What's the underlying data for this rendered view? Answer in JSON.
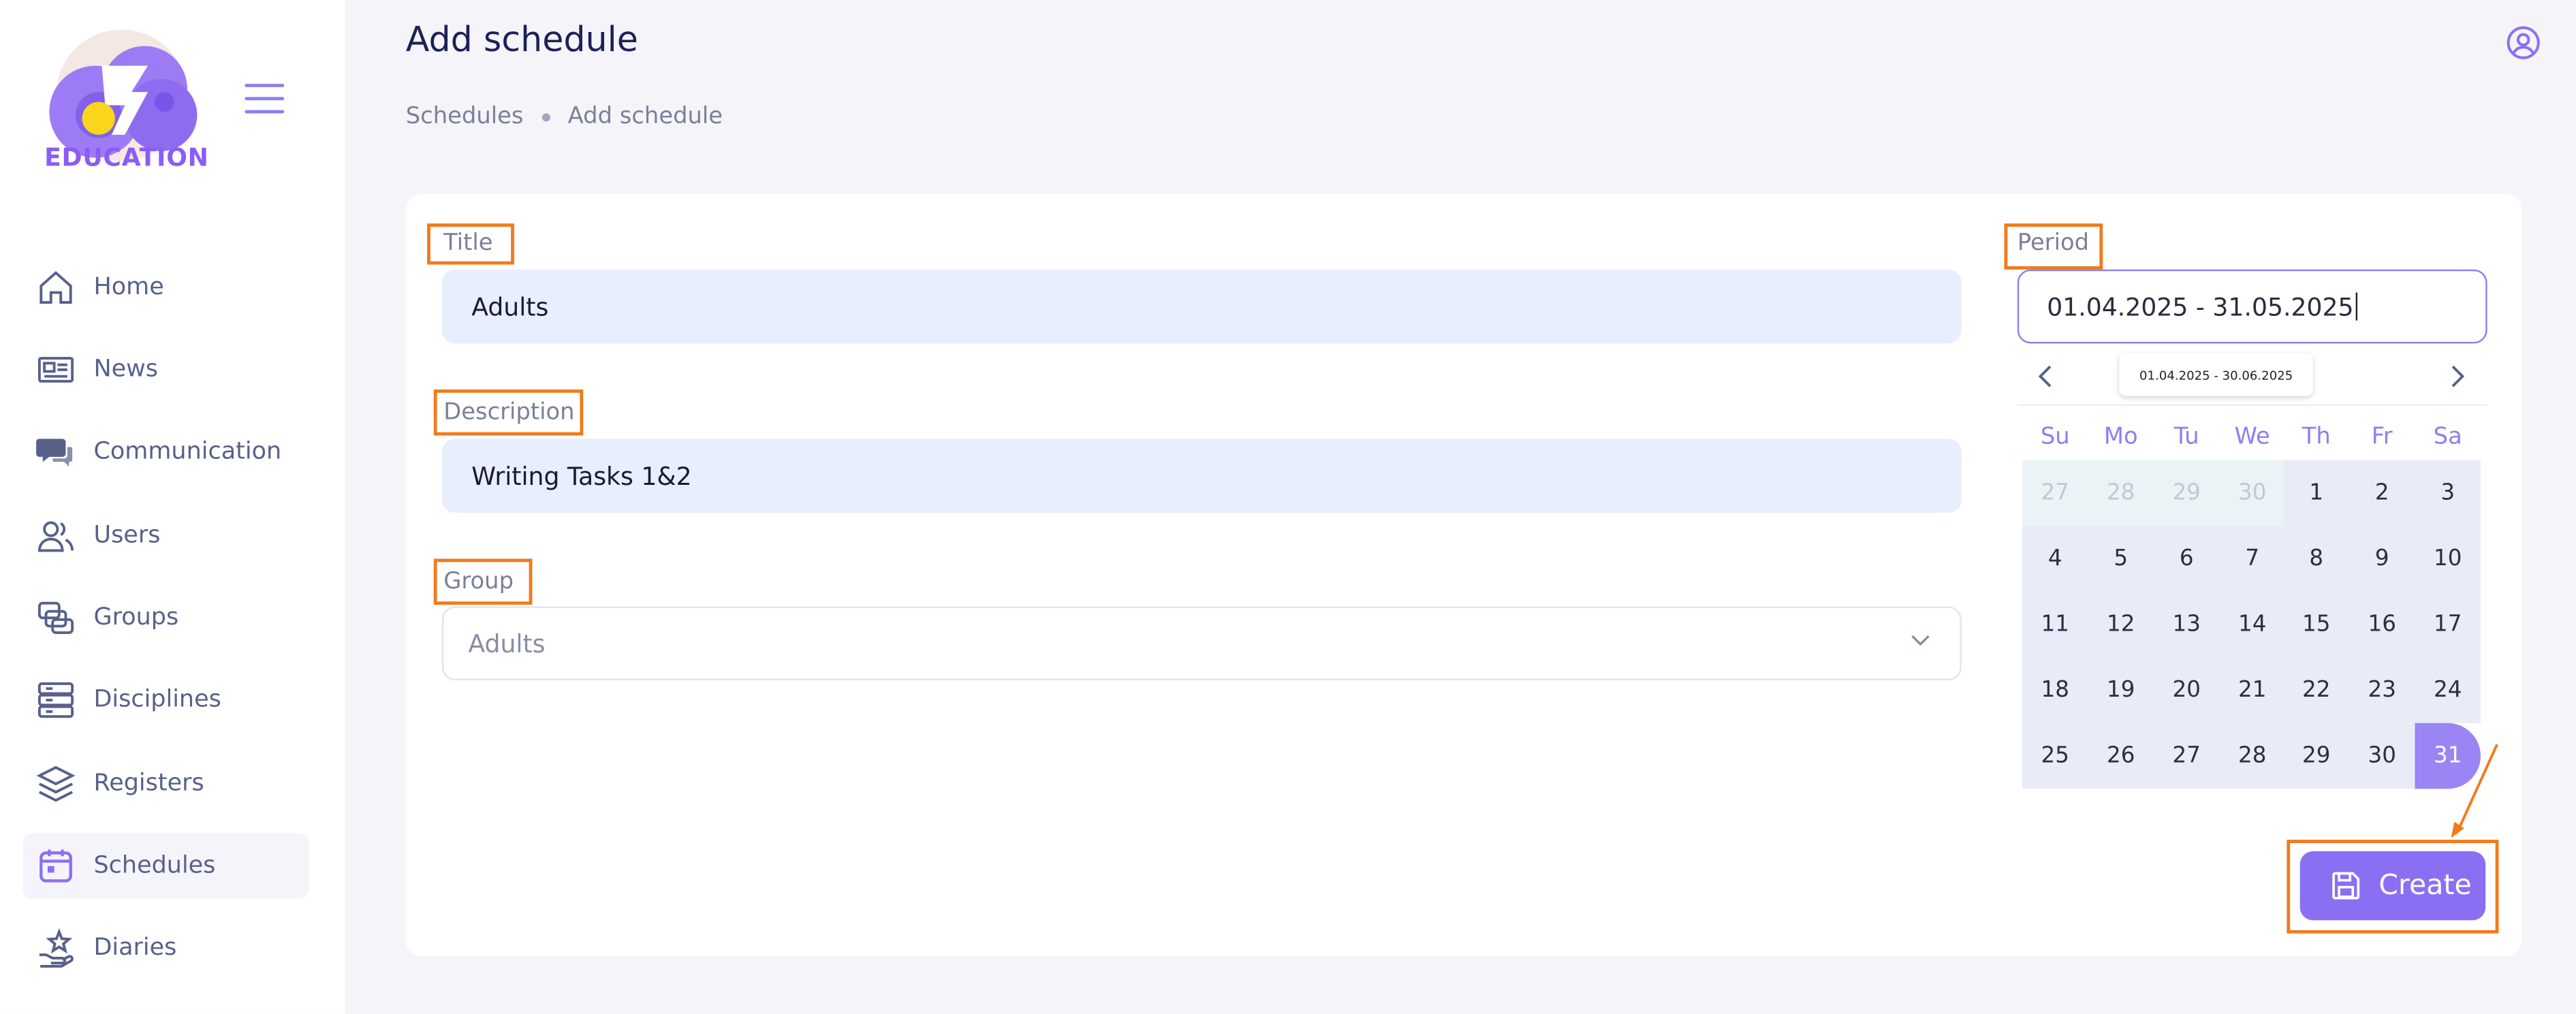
{
  "brand": {
    "name": "EDUCATION"
  },
  "sidebar": {
    "items": [
      {
        "label": "Home",
        "icon": "home-icon"
      },
      {
        "label": "News",
        "icon": "newspaper-icon"
      },
      {
        "label": "Communication",
        "icon": "chat-icon"
      },
      {
        "label": "Users",
        "icon": "users-icon"
      },
      {
        "label": "Groups",
        "icon": "groups-icon"
      },
      {
        "label": "Disciplines",
        "icon": "server-icon"
      },
      {
        "label": "Registers",
        "icon": "layers-icon"
      },
      {
        "label": "Schedules",
        "icon": "calendar-icon",
        "active": true
      },
      {
        "label": "Diaries",
        "icon": "star-hand-icon"
      }
    ]
  },
  "header": {
    "title": "Add schedule",
    "breadcrumb": [
      "Schedules",
      "Add schedule"
    ]
  },
  "form": {
    "title_label": "Title",
    "title_value": "Adults",
    "description_label": "Description",
    "description_value": "Writing Tasks 1&2",
    "group_label": "Group",
    "group_value": "Adults",
    "period_label": "Period",
    "period_value": "01.04.2025 - 31.05.2025"
  },
  "calendar": {
    "tooltip": "01.04.2025 - 30.06.2025",
    "weekdays": [
      "Su",
      "Mo",
      "Tu",
      "We",
      "Th",
      "Fr",
      "Sa"
    ],
    "weeks": [
      [
        "27",
        "28",
        "29",
        "30",
        "1",
        "2",
        "3"
      ],
      [
        "4",
        "5",
        "6",
        "7",
        "8",
        "9",
        "10"
      ],
      [
        "11",
        "12",
        "13",
        "14",
        "15",
        "16",
        "17"
      ],
      [
        "18",
        "19",
        "20",
        "21",
        "22",
        "23",
        "24"
      ],
      [
        "25",
        "26",
        "27",
        "28",
        "29",
        "30",
        "31"
      ]
    ],
    "outside_month_days": 4,
    "selected_day": "31"
  },
  "actions": {
    "create_label": "Create"
  },
  "colors": {
    "accent": "#8b6ff3",
    "highlight": "#f27a1b",
    "input_bg": "#e8eefc"
  }
}
